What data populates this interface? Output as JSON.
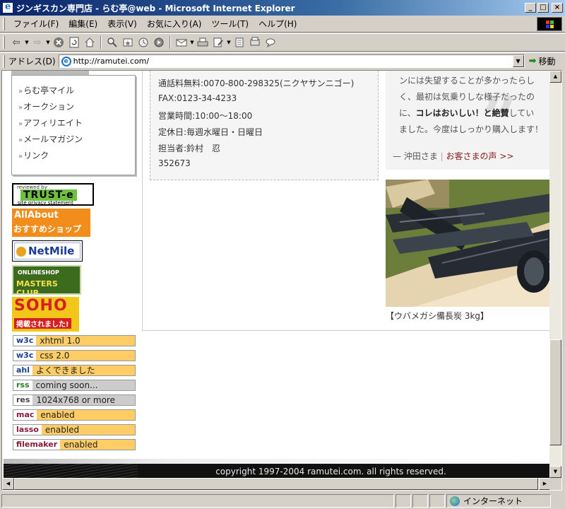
{
  "window": {
    "title": "ジンギスカン専門店 - らむ亭@web - Microsoft Internet Explorer",
    "minimize": "_",
    "maximize": "□",
    "close": "×"
  },
  "menu": {
    "items": [
      "ファイル(F)",
      "編集(E)",
      "表示(V)",
      "お気に入り(A)",
      "ツール(T)",
      "ヘルプ(H)"
    ]
  },
  "toolbar": {
    "icons": [
      "back-icon",
      "forward-icon",
      "stop-icon",
      "refresh-icon",
      "home-icon",
      "search-icon",
      "favorites-icon",
      "history-icon",
      "media-icon",
      "mail-icon",
      "print-icon",
      "edit-icon",
      "discuss-icon",
      "messenger-icon",
      "research-icon"
    ]
  },
  "address": {
    "label": "アドレス(D)",
    "url": "http://ramutei.com/",
    "go_label": "移動"
  },
  "sidebar": {
    "nav": [
      "らむ亭マイル",
      "オークション",
      "アフィリエイト",
      "メールマガジン",
      "リンク"
    ],
    "nav_marker": "»",
    "badges": {
      "trust_small": "reviewed by",
      "trust_main": "TRUST-e",
      "trust_sub": "site privacy statement",
      "allabout_1": "AllAbout",
      "allabout_2": "おすすめショップ",
      "netmile": "NetMile",
      "masters_1": "ONLINESHOP",
      "masters_2": "MASTERS CLUB",
      "soho_1": "SOHO",
      "soho_2": "掲載されました!"
    },
    "tags": [
      {
        "key": "w3c",
        "value": "xhtml 1.0",
        "key_color": "#1a3d94",
        "bg": "#ffcc66"
      },
      {
        "key": "w3c",
        "value": "css 2.0",
        "key_color": "#1a3d94",
        "bg": "#ffcc66"
      },
      {
        "key": "ahl",
        "value": "よくできました",
        "key_color": "#1a3d94",
        "bg": "#ffcc66"
      },
      {
        "key": "rss",
        "value": "coming soon...",
        "key_color": "#2a7a2a",
        "bg": "#cccccc"
      },
      {
        "key": "res",
        "value": "1024x768 or more",
        "key_color": "#444444",
        "bg": "#cccccc"
      },
      {
        "key": "mac",
        "value": "enabled",
        "key_color": "#8a1a3a",
        "bg": "#ffcc66"
      },
      {
        "key": "lasso",
        "value": "enabled",
        "key_color": "#8a1a3a",
        "bg": "#ffcc66"
      },
      {
        "key": "filemaker",
        "value": "enabled",
        "key_color": "#8a1a3a",
        "bg": "#ffcc66"
      }
    ]
  },
  "contact": {
    "tollfree": "通話料無料:0070-800-298325(ニクヤサンニゴー)",
    "fax": "FAX:0123-34-4233",
    "hours": "営業時間:10:00〜18:00",
    "holiday": "定休日:毎週水曜日・日曜日",
    "person": "担当者:鈴村　忍",
    "code": "352673"
  },
  "testimonial": {
    "line1": "ンには失望することが多かったらし",
    "line2": "く、最初は気乗りしな様子だったの",
    "line3_pre": "に、",
    "line3_bold": "コレはおいしい！と絶賛",
    "line3_post": "してい",
    "line4": "ました。今度はしっかり購入します！",
    "quote_mark": "”",
    "sign_name": "— 沖田さま",
    "sign_sep": " | ",
    "sign_link": "お客さまの声 >>"
  },
  "product": {
    "caption": "【ウバメガシ備長炭 3kg】"
  },
  "footer": {
    "copyright": "copyright 1997-2004 ramutei.com. all rights reserved."
  },
  "status": {
    "zone": "インターネット"
  }
}
